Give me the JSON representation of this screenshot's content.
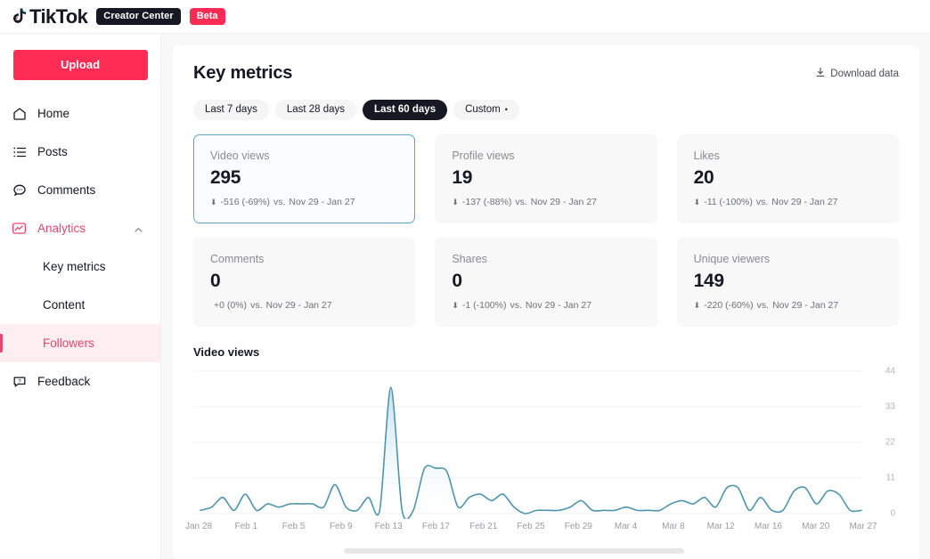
{
  "topbar": {
    "brand": "TikTok",
    "creator_center_badge": "Creator Center",
    "beta_badge": "Beta",
    "logo_icon": "tiktok-note-icon"
  },
  "sidebar": {
    "upload_label": "Upload",
    "items": [
      {
        "label": "Home",
        "icon": "home-icon"
      },
      {
        "label": "Posts",
        "icon": "list-icon"
      },
      {
        "label": "Comments",
        "icon": "comment-bubble-icon"
      },
      {
        "label": "Analytics",
        "icon": "analytics-chart-icon",
        "expanded": true,
        "chevron": "chevron-up-icon"
      },
      {
        "label": "Feedback",
        "icon": "feedback-question-icon"
      }
    ],
    "analytics_children": [
      {
        "label": "Key metrics",
        "current": false
      },
      {
        "label": "Content",
        "current": false
      },
      {
        "label": "Followers",
        "current": true
      }
    ],
    "accent_color": "#e8456f",
    "upload_color": "#fe2c55"
  },
  "header": {
    "title": "Key metrics",
    "download_label": "Download data",
    "download_icon": "download-icon"
  },
  "range_tabs": [
    {
      "label": "Last 7 days",
      "selected": false
    },
    {
      "label": "Last 28 days",
      "selected": false
    },
    {
      "label": "Last 60 days",
      "selected": true
    },
    {
      "label": "Custom",
      "selected": false,
      "caret": "•"
    }
  ],
  "comparison_period": "Nov 29 - Jan 27",
  "metrics": [
    {
      "label": "Video views",
      "value": "295",
      "delta": "-516 (-69%)",
      "vs": "vs.",
      "period": "Nov 29 - Jan 27",
      "direction": "down",
      "arrow": "⬇",
      "selected": true
    },
    {
      "label": "Profile views",
      "value": "19",
      "delta": "-137 (-88%)",
      "vs": "vs.",
      "period": "Nov 29 - Jan 27",
      "direction": "down",
      "arrow": "⬇",
      "selected": false
    },
    {
      "label": "Likes",
      "value": "20",
      "delta": "-11 (-100%)",
      "vs": "vs.",
      "period": "Nov 29 - Jan 27",
      "direction": "down",
      "arrow": "⬇",
      "selected": false
    },
    {
      "label": "Comments",
      "value": "0",
      "delta": "+0 (0%)",
      "vs": "vs.",
      "period": "Nov 29 - Jan 27",
      "direction": "flat",
      "arrow": "",
      "selected": false
    },
    {
      "label": "Shares",
      "value": "0",
      "delta": "-1 (-100%)",
      "vs": "vs.",
      "period": "Nov 29 - Jan 27",
      "direction": "down",
      "arrow": "⬇",
      "selected": false
    },
    {
      "label": "Unique viewers",
      "value": "149",
      "delta": "-220 (-60%)",
      "vs": "vs.",
      "period": "Nov 29 - Jan 27",
      "direction": "down",
      "arrow": "⬇",
      "selected": false
    }
  ],
  "chart_section": {
    "title": "Video views"
  },
  "chart_data": {
    "type": "area",
    "title": "Video views",
    "xlabel": "",
    "ylabel": "",
    "ylim": [
      0,
      44
    ],
    "yticks": [
      0,
      11,
      22,
      33,
      44
    ],
    "grid": true,
    "legend": "none",
    "line_color": "#4f94ad",
    "fill_top_color": "#b8dcea",
    "fill_bottom_color": "#ffffff",
    "tick_labels": [
      "Jan 28",
      "Feb 1",
      "Feb 5",
      "Feb 9",
      "Feb 13",
      "Feb 17",
      "Feb 21",
      "Feb 25",
      "Feb 29",
      "Mar 4",
      "Mar 8",
      "Mar 12",
      "Mar 16",
      "Mar 20",
      "Mar 27"
    ],
    "x": [
      "Jan 28",
      "Jan 29",
      "Jan 30",
      "Jan 31",
      "Feb 1",
      "Feb 2",
      "Feb 3",
      "Feb 4",
      "Feb 5",
      "Feb 6",
      "Feb 7",
      "Feb 8",
      "Feb 9",
      "Feb 10",
      "Feb 11",
      "Feb 12",
      "Feb 13",
      "Feb 14",
      "Feb 15",
      "Feb 16",
      "Feb 17",
      "Feb 18",
      "Feb 19",
      "Feb 20",
      "Feb 21",
      "Feb 22",
      "Feb 23",
      "Feb 24",
      "Feb 25",
      "Feb 26",
      "Feb 27",
      "Feb 28",
      "Feb 29",
      "Mar 1",
      "Mar 2",
      "Mar 3",
      "Mar 4",
      "Mar 5",
      "Mar 6",
      "Mar 7",
      "Mar 8",
      "Mar 9",
      "Mar 10",
      "Mar 11",
      "Mar 12",
      "Mar 13",
      "Mar 14",
      "Mar 15",
      "Mar 16",
      "Mar 17",
      "Mar 18",
      "Mar 19",
      "Mar 20",
      "Mar 21",
      "Mar 22",
      "Mar 23",
      "Mar 24",
      "Mar 25",
      "Mar 26",
      "Mar 27"
    ],
    "values": [
      1,
      2,
      5,
      1,
      6,
      1,
      3,
      2,
      3,
      3,
      3,
      2,
      9,
      2,
      1,
      5,
      1,
      39,
      1,
      1,
      14,
      14,
      13,
      2,
      5,
      6,
      4,
      6,
      2,
      0,
      1,
      1,
      1,
      2,
      4,
      1,
      1,
      1,
      2,
      1,
      1,
      1,
      3,
      4,
      3,
      5,
      2,
      8,
      8,
      1,
      5,
      1,
      1,
      7,
      8,
      3,
      7,
      6,
      1,
      1
    ],
    "series": [
      {
        "name": "Video views",
        "values": [
          1,
          2,
          5,
          1,
          6,
          1,
          3,
          2,
          3,
          3,
          3,
          2,
          9,
          2,
          1,
          5,
          1,
          39,
          1,
          1,
          14,
          14,
          13,
          2,
          5,
          6,
          4,
          6,
          2,
          0,
          1,
          1,
          1,
          2,
          4,
          1,
          1,
          1,
          2,
          1,
          1,
          1,
          3,
          4,
          3,
          5,
          2,
          8,
          8,
          1,
          5,
          1,
          1,
          7,
          8,
          3,
          7,
          6,
          1,
          1
        ]
      }
    ]
  },
  "scrollbar": {
    "orientation": "horizontal"
  }
}
